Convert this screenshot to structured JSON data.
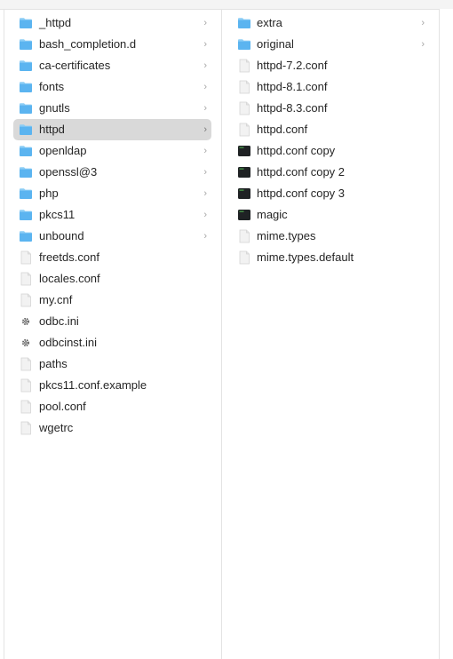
{
  "columns": [
    {
      "items": [
        {
          "name": "_httpd",
          "kind": "folder",
          "chevron": "›"
        },
        {
          "name": "bash_completion.d",
          "kind": "folder",
          "chevron": "›"
        },
        {
          "name": "ca-certificates",
          "kind": "folder",
          "chevron": "›"
        },
        {
          "name": "fonts",
          "kind": "folder",
          "chevron": "›"
        },
        {
          "name": "gnutls",
          "kind": "folder",
          "chevron": "›"
        },
        {
          "name": "httpd",
          "kind": "folder",
          "chevron": "›",
          "selected": true
        },
        {
          "name": "openldap",
          "kind": "folder",
          "chevron": "›"
        },
        {
          "name": "openssl@3",
          "kind": "folder",
          "chevron": "›"
        },
        {
          "name": "php",
          "kind": "folder",
          "chevron": "›"
        },
        {
          "name": "pkcs11",
          "kind": "folder",
          "chevron": "›"
        },
        {
          "name": "unbound",
          "kind": "folder",
          "chevron": "›"
        },
        {
          "name": "freetds.conf",
          "kind": "file"
        },
        {
          "name": "locales.conf",
          "kind": "file"
        },
        {
          "name": "my.cnf",
          "kind": "file"
        },
        {
          "name": "odbc.ini",
          "kind": "gear"
        },
        {
          "name": "odbcinst.ini",
          "kind": "gear"
        },
        {
          "name": "paths",
          "kind": "file"
        },
        {
          "name": "pkcs11.conf.example",
          "kind": "file"
        },
        {
          "name": "pool.conf",
          "kind": "file"
        },
        {
          "name": "wgetrc",
          "kind": "file"
        }
      ]
    },
    {
      "items": [
        {
          "name": "extra",
          "kind": "folder",
          "chevron": "›"
        },
        {
          "name": "original",
          "kind": "folder",
          "chevron": "›"
        },
        {
          "name": "httpd-7.2.conf",
          "kind": "file"
        },
        {
          "name": "httpd-8.1.conf",
          "kind": "file"
        },
        {
          "name": "httpd-8.3.conf",
          "kind": "file"
        },
        {
          "name": "httpd.conf",
          "kind": "file"
        },
        {
          "name": "httpd.conf copy",
          "kind": "exec"
        },
        {
          "name": "httpd.conf copy 2",
          "kind": "exec"
        },
        {
          "name": "httpd.conf copy 3",
          "kind": "exec"
        },
        {
          "name": "magic",
          "kind": "exec"
        },
        {
          "name": "mime.types",
          "kind": "file"
        },
        {
          "name": "mime.types.default",
          "kind": "file"
        }
      ]
    }
  ],
  "colors": {
    "folder_body": "#5bb4f0",
    "folder_tab": "#8ccdf5",
    "selection": "#d9d9d9",
    "exec_bg": "#1f2224",
    "exec_accent": "#4a9a4a"
  }
}
